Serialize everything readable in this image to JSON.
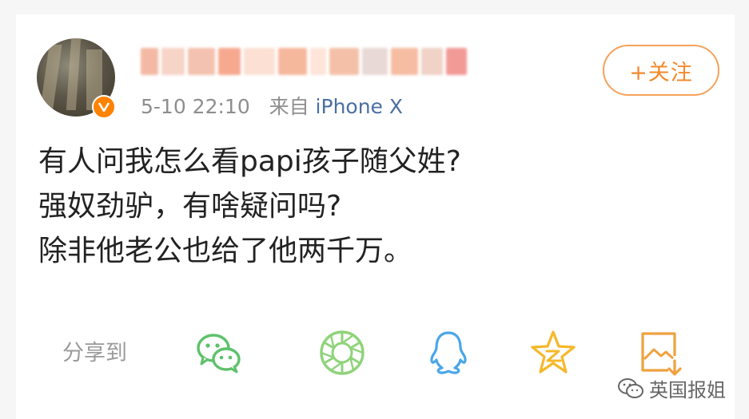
{
  "post": {
    "username": "",
    "timestamp": "5-10 22:10",
    "source_prefix": "来自",
    "source": "iPhone X",
    "follow_label": "+关注",
    "lines": [
      "有人问我怎么看papi孩子随父姓?",
      "强奴劲驴，有啥疑问吗?",
      "除非他老公也给了他两千万。"
    ]
  },
  "share": {
    "label": "分享到",
    "targets": [
      {
        "icon": "wechat-icon",
        "color": "#5ec16b"
      },
      {
        "icon": "moments-icon",
        "color": "#8fd37a"
      },
      {
        "icon": "qq-icon",
        "color": "#4aa6e8"
      },
      {
        "icon": "qzone-icon",
        "color": "#f6b82a"
      },
      {
        "icon": "save-image-icon",
        "color": "#f0a13e"
      }
    ]
  },
  "watermark": {
    "text": "英国报姐"
  },
  "colors": {
    "accent": "#f28a2e",
    "verified": "#ff8200",
    "link": "#4a6fa1"
  }
}
